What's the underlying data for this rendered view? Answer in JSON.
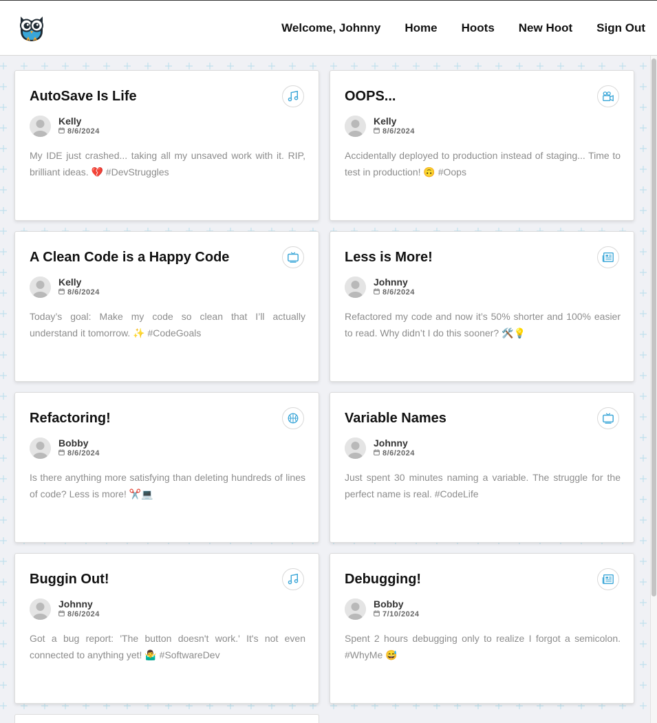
{
  "header": {
    "logo": "owl-logo",
    "nav": {
      "welcome": "Welcome, Johnny",
      "home": "Home",
      "hoots": "Hoots",
      "new_hoot": "New Hoot",
      "sign_out": "Sign Out"
    }
  },
  "colors": {
    "accent": "#3aa6d8",
    "background": "#f0f1f5",
    "pattern": "#bfe0ec"
  },
  "hoots": [
    {
      "title": "AutoSave Is Life",
      "author": "Kelly",
      "date": "8/6/2024",
      "category_icon": "music-icon",
      "text": "My IDE just crashed... taking all my unsaved work with it. RIP, brilliant ideas. 💔 #DevStruggles"
    },
    {
      "title": "OOPS...",
      "author": "Kelly",
      "date": "8/6/2024",
      "category_icon": "video-camera-icon",
      "text": "Accidentally deployed to production instead of staging... Time to test in production! 🙃 #Oops"
    },
    {
      "title": "A Clean Code is a Happy Code",
      "author": "Kelly",
      "date": "8/6/2024",
      "category_icon": "tv-icon",
      "text": "Today’s goal: Make my code so clean that I’ll actually understand it tomorrow. ✨ #CodeGoals"
    },
    {
      "title": "Less is More!",
      "author": "Johnny",
      "date": "8/6/2024",
      "category_icon": "newspaper-icon",
      "text": "Refactored my code and now it’s 50% shorter and 100% easier to read. Why didn’t I do this sooner? 🛠️💡"
    },
    {
      "title": "Refactoring!",
      "author": "Bobby",
      "date": "8/6/2024",
      "category_icon": "basketball-icon",
      "text": "Is there anything more satisfying than deleting hundreds of lines of code? Less is more! ✂️💻"
    },
    {
      "title": "Variable Names",
      "author": "Johnny",
      "date": "8/6/2024",
      "category_icon": "tv-icon",
      "text": "Just spent 30 minutes naming a variable. The struggle for the perfect name is real. #CodeLife"
    },
    {
      "title": "Buggin Out!",
      "author": "Johnny",
      "date": "8/6/2024",
      "category_icon": "music-icon",
      "text": "Got a bug report: 'The button doesn't work.' It's not even connected to anything yet! 🤷‍♂️ #SoftwareDev"
    },
    {
      "title": "Debugging!",
      "author": "Bobby",
      "date": "7/10/2024",
      "category_icon": "newspaper-icon",
      "text": "Spent 2 hours debugging only to realize I forgot a semicolon. #WhyMe 😅"
    }
  ]
}
